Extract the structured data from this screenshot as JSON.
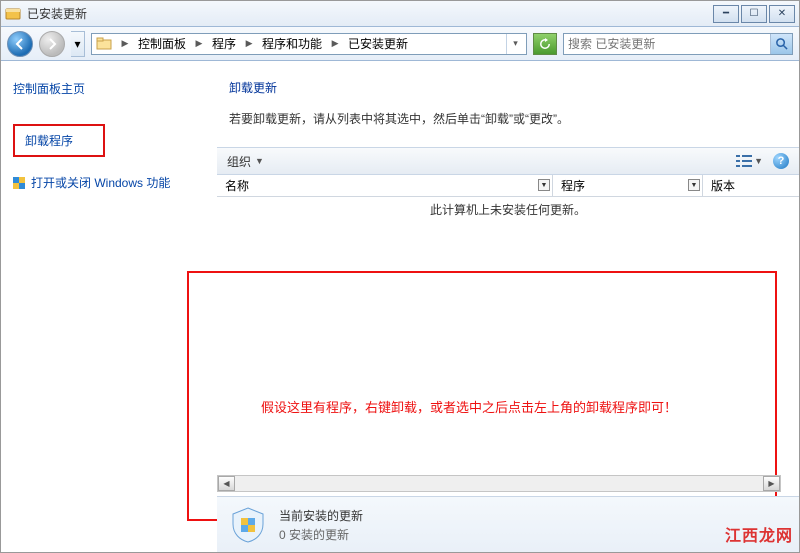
{
  "window": {
    "title": "已安装更新",
    "minimize_tip": "最小化",
    "maximize_tip": "最大化",
    "close_tip": "关闭"
  },
  "breadcrumbs": [
    {
      "label": "控制面板"
    },
    {
      "label": "程序"
    },
    {
      "label": "程序和功能"
    },
    {
      "label": "已安装更新"
    }
  ],
  "search": {
    "placeholder": "搜索 已安装更新"
  },
  "sidebar": {
    "home": "控制面板主页",
    "uninstall": "卸载程序",
    "windows_features": "打开或关闭 Windows 功能"
  },
  "main": {
    "heading": "卸载更新",
    "description": "若要卸载更新，请从列表中将其选中，然后单击“卸载”或“更改”。"
  },
  "toolbar": {
    "organize": "组织"
  },
  "columns": {
    "name": "名称",
    "program": "程序",
    "version": "版本"
  },
  "list": {
    "empty": "此计算机上未安装任何更新。"
  },
  "annotation": {
    "text": "假设这里有程序，右键卸载，或者选中之后点击左上角的卸载程序即可！"
  },
  "footer": {
    "line1": "当前安装的更新",
    "line2": "0 安装的更新"
  },
  "watermark": "江西龙网"
}
